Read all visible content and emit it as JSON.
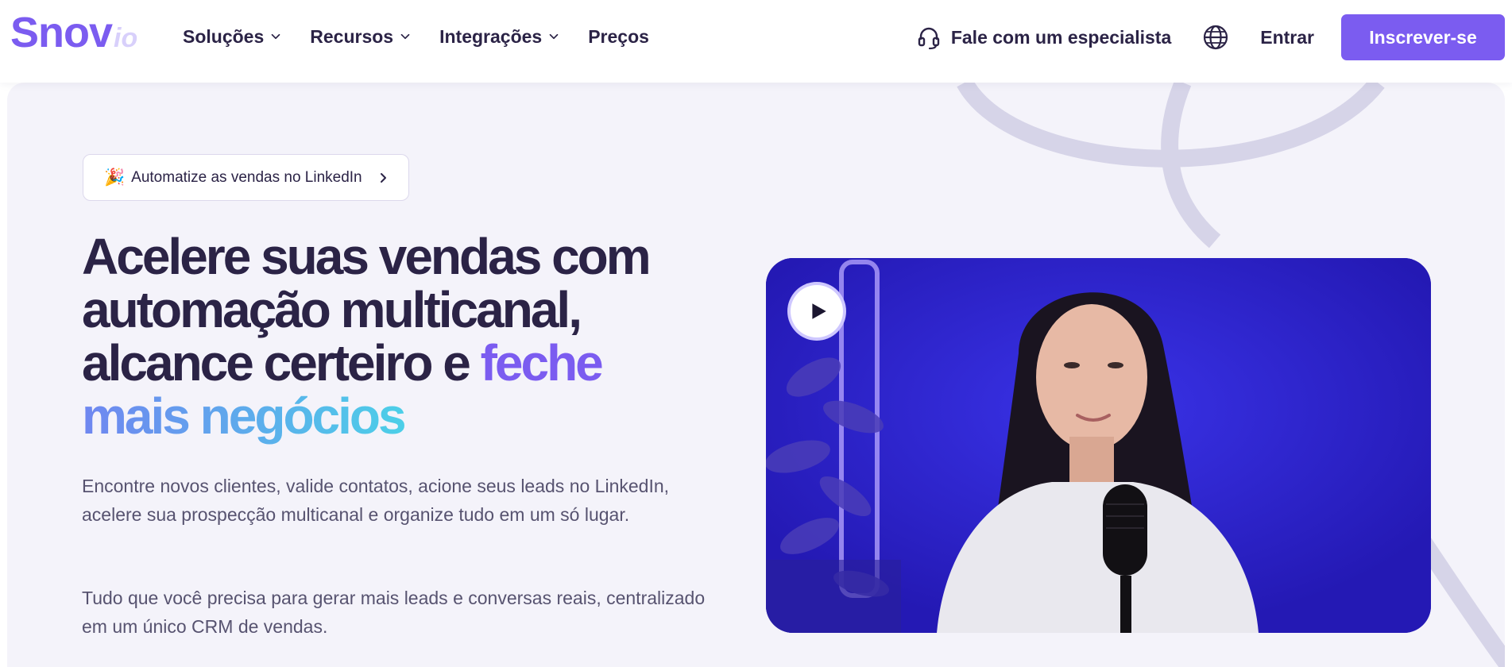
{
  "logo": {
    "main": "Snov",
    "suffix": "io"
  },
  "nav": {
    "items": [
      {
        "label": "Soluções",
        "has_dropdown": true
      },
      {
        "label": "Recursos",
        "has_dropdown": true
      },
      {
        "label": "Integrações",
        "has_dropdown": true
      },
      {
        "label": "Preços",
        "has_dropdown": false
      }
    ],
    "specialist_label": "Fale com um especialista",
    "specialist_icon": "headset-icon",
    "language_icon": "globe-icon",
    "login_label": "Entrar",
    "signup_label": "Inscrever-se"
  },
  "hero": {
    "chip": {
      "emoji": "🎉",
      "label": "Automatize as vendas no LinkedIn",
      "icon": "chevron-right-icon"
    },
    "headline": {
      "part1": "Acelere suas vendas com automação multicanal, alcance certeiro e ",
      "highlight_purple": "feche",
      "highlight_gradient": "mais negócios"
    },
    "paragraph_1": "Encontre novos clientes, valide contatos, acione seus leads no LinkedIn, acelere sua prospecção multicanal e organize tudo em um só lugar.",
    "paragraph_2": "Tudo que você precisa para gerar mais leads e conversas reais, centralizado em um único CRM de vendas.",
    "video": {
      "play_icon": "play-icon"
    }
  },
  "colors": {
    "brand": "#7b5cf0",
    "heading": "#2b2346",
    "body_text": "#575370",
    "hero_bg": "#f4f3fa",
    "gradient_start": "#6f86f0",
    "gradient_end": "#4ccfe8"
  }
}
